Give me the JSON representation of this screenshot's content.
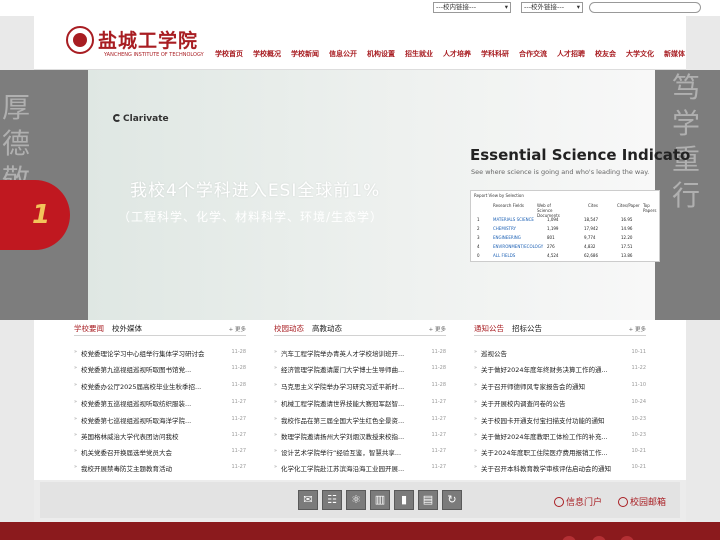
{
  "topbar": {
    "internal_links": "---校内链接---",
    "external_links": "---校外链接---"
  },
  "header": {
    "school_name_cn": "盐城工学院",
    "school_name_en": "YANCHENG INSTITUTE OF TECHNOLOGY",
    "nav": [
      "学校首页",
      "学校概况",
      "学校新闻",
      "信息公开",
      "机构设置",
      "招生就业",
      "人才培养",
      "学科科研",
      "合作交流",
      "人才招聘",
      "校友会",
      "大学文化",
      "新媒体"
    ]
  },
  "banner": {
    "clarivate": "Clarivate",
    "headline": "我校4个学科进入ESI全球前1%",
    "subheadline": "（工程科学、化学、材料科学、环境/生态学）",
    "esi_title": "Essential Science Indicato",
    "esi_sub": "See where science is going and who's leading the way.",
    "esi_report": "Report View by Selection",
    "esi_headers": [
      "Research Fields",
      "Web of Science Documents",
      "Cites",
      "Cites/Paper",
      "Top Papers"
    ],
    "esi_rows": [
      {
        "n": "1",
        "field": "MATERIALS SCIENCE",
        "docs": "1,094",
        "cites": "18,547",
        "cpp": "16.95"
      },
      {
        "n": "2",
        "field": "CHEMISTRY",
        "docs": "1,199",
        "cites": "17,942",
        "cpp": "14.96"
      },
      {
        "n": "3",
        "field": "ENGINEERING",
        "docs": "801",
        "cites": "9,774",
        "cpp": "12.20"
      },
      {
        "n": "4",
        "field": "ENVIRONMENT/ECOLOGY",
        "docs": "276",
        "cites": "4,832",
        "cpp": "17.51"
      },
      {
        "n": "0",
        "field": "ALL FIELDS",
        "docs": "4,524",
        "cites": "62,686",
        "cpp": "13.86"
      }
    ],
    "calligraphy_left": "厚德敬致",
    "calligraphy_right": "笃学重行",
    "red_badge": "1"
  },
  "sections": [
    {
      "tab_active": "学校要闻",
      "tab_other": "校外媒体",
      "more": "+ 更多",
      "items": [
        {
          "title": "校党委理论学习中心组举行集体学习研讨会",
          "date": "11-28"
        },
        {
          "title": "校党委第九巡视组巡视听取图书馆党...",
          "date": "11-28"
        },
        {
          "title": "校党委办公厅2025届高校毕业生秋季招...",
          "date": "11-28"
        },
        {
          "title": "校党委第五巡视组巡视听取纺织服装...",
          "date": "11-27"
        },
        {
          "title": "校党委第七巡视组巡视听取海洋学院...",
          "date": "11-27"
        },
        {
          "title": "英国格林威治大学代表团访问我校",
          "date": "11-27"
        },
        {
          "title": "机关党委召开换届选举党员大会",
          "date": "11-27"
        },
        {
          "title": "我校开展禁毒防艾主题教育活动",
          "date": "11-27"
        }
      ]
    },
    {
      "tab_active": "校园动态",
      "tab_other": "高教动态",
      "more": "+ 更多",
      "items": [
        {
          "title": "汽车工程学院举办青英人才学校培训班开...",
          "date": "11-28"
        },
        {
          "title": "经济管理学院邀请厦门大学博士生导师曲...",
          "date": "11-28"
        },
        {
          "title": "马克思主义学院举办学习研究习近平新时...",
          "date": "11-28"
        },
        {
          "title": "机械工程学院邀请世界技能大赛冠军赵智...",
          "date": "11-27"
        },
        {
          "title": "我校作品在第三届全国大学生红色全景资...",
          "date": "11-27"
        },
        {
          "title": "数理学院邀请扬州大学刘烟汉教授来校指...",
          "date": "11-27"
        },
        {
          "title": "设计艺术学院举行“经验互鉴，智慧共享...",
          "date": "11-27"
        },
        {
          "title": "化学化工学院赴江苏滨海沿海工业园开展...",
          "date": "11-27"
        }
      ]
    },
    {
      "tab_active": "通知公告",
      "tab_other": "招标公告",
      "more": "+ 更多",
      "items": [
        {
          "title": "巡视公告",
          "date": "10-11"
        },
        {
          "title": "关于做好2024年度年终财务决算工作的通...",
          "date": "11-22"
        },
        {
          "title": "关于召开师德师风专家报告会的通知",
          "date": "11-10"
        },
        {
          "title": "关于开展校内调查问卷的公告",
          "date": "10-24"
        },
        {
          "title": "关于校园卡开通支付宝扫描支付功能的通知",
          "date": "10-23"
        },
        {
          "title": "关于做好2024年度教职工体检工作的补充...",
          "date": "10-23"
        },
        {
          "title": "关于2024年度职工住院医疗费用报销工作...",
          "date": "10-21"
        },
        {
          "title": "关于召开本科教育教学审核评估启动会的通知",
          "date": "10-21"
        }
      ]
    }
  ],
  "quicklinks": {
    "portal": "信息门户",
    "mail": "校园邮箱"
  },
  "colors": {
    "brand_red": "#a81d22",
    "footer_red": "#8b1a1d",
    "banner_grey": "#7d7d7d"
  }
}
